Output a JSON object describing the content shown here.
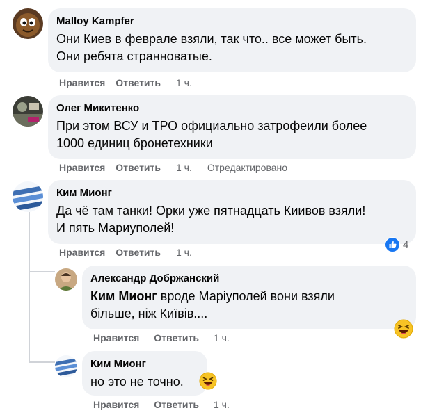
{
  "comments": [
    {
      "author": "Malloy Kampfer",
      "text_lines": [
        "Они Киев в феврале взяли, так что.. все может быть.",
        "Они ребята странноватые."
      ],
      "like": "Нравится",
      "reply": "Ответить",
      "time": "1 ч."
    },
    {
      "author": "Олег Микитенко",
      "text_lines": [
        "При этом ВСУ и ТРО официально затрофеили более",
        "1000 единиц бронетехники"
      ],
      "like": "Нравится",
      "reply": "Ответить",
      "time": "1 ч.",
      "edited": "Отредактировано"
    },
    {
      "author": "Ким Мионг",
      "text_lines": [
        "Да чё там танки! Орки уже пятнадцать Киивов взяли!",
        "И пять Мариуполей!"
      ],
      "like": "Нравится",
      "reply": "Ответить",
      "time": "1 ч.",
      "reaction_count": "4"
    }
  ],
  "replies": [
    {
      "author": "Александр Добржанский",
      "mention": "Ким Мионг",
      "text_line1_rest": " вроде Маріуполей вони взяли",
      "text_line2": "більше, ніж Київів....",
      "like": "Нравится",
      "reply": "Ответить",
      "time": "1 ч."
    },
    {
      "author": "Ким Мионг",
      "text": "но это не точно.",
      "like": "Нравится",
      "reply": "Ответить",
      "time": "1 ч."
    }
  ],
  "colors": {
    "bubble": "#f0f2f5",
    "meta": "#65676b",
    "like_blue": "#1877f2",
    "emoji_yellow": "#f7c325"
  },
  "icons": [
    "like-reaction-icon",
    "laughing-emoji-icon"
  ]
}
